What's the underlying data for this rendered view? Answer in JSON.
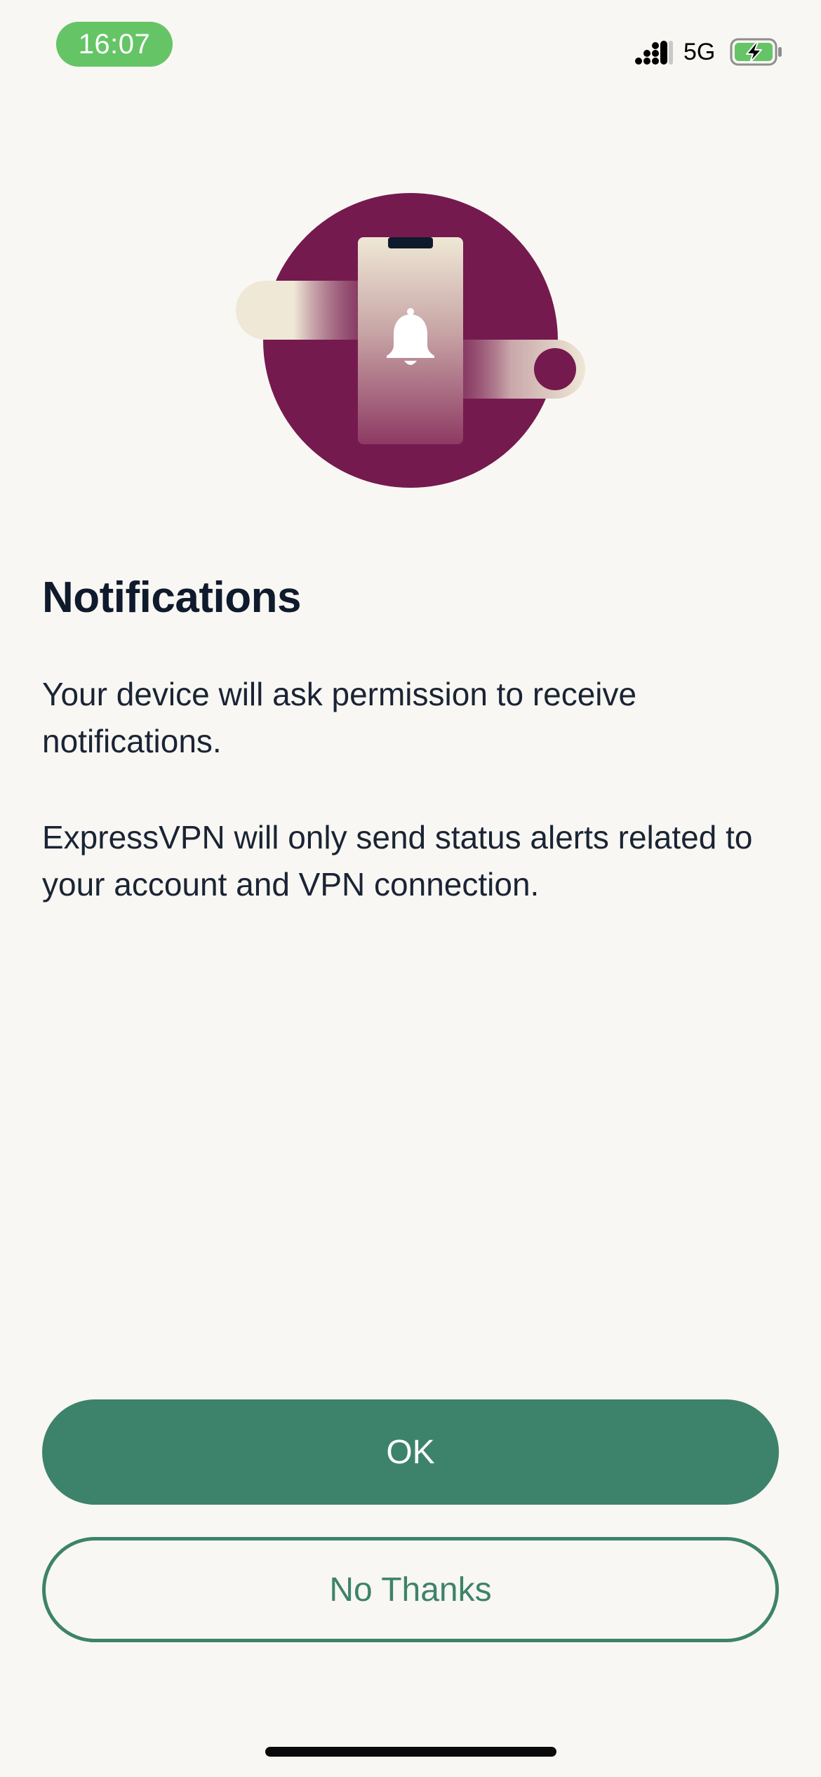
{
  "status_bar": {
    "time": "16:07",
    "network": "5G",
    "icons": [
      "signal-icon",
      "battery-charging-icon"
    ],
    "time_pill_color": "#65c466"
  },
  "illustration": {
    "icon": "bell-icon",
    "primary_color": "#751a4f",
    "accent_color": "#efe8d6"
  },
  "content": {
    "title": "Notifications",
    "paragraph_1": "Your device will ask permission to receive notifications.",
    "paragraph_2": "ExpressVPN will only send status alerts related to your account and VPN connection."
  },
  "actions": {
    "ok_label": "OK",
    "no_thanks_label": "No Thanks",
    "accent_color": "#3d836c"
  }
}
